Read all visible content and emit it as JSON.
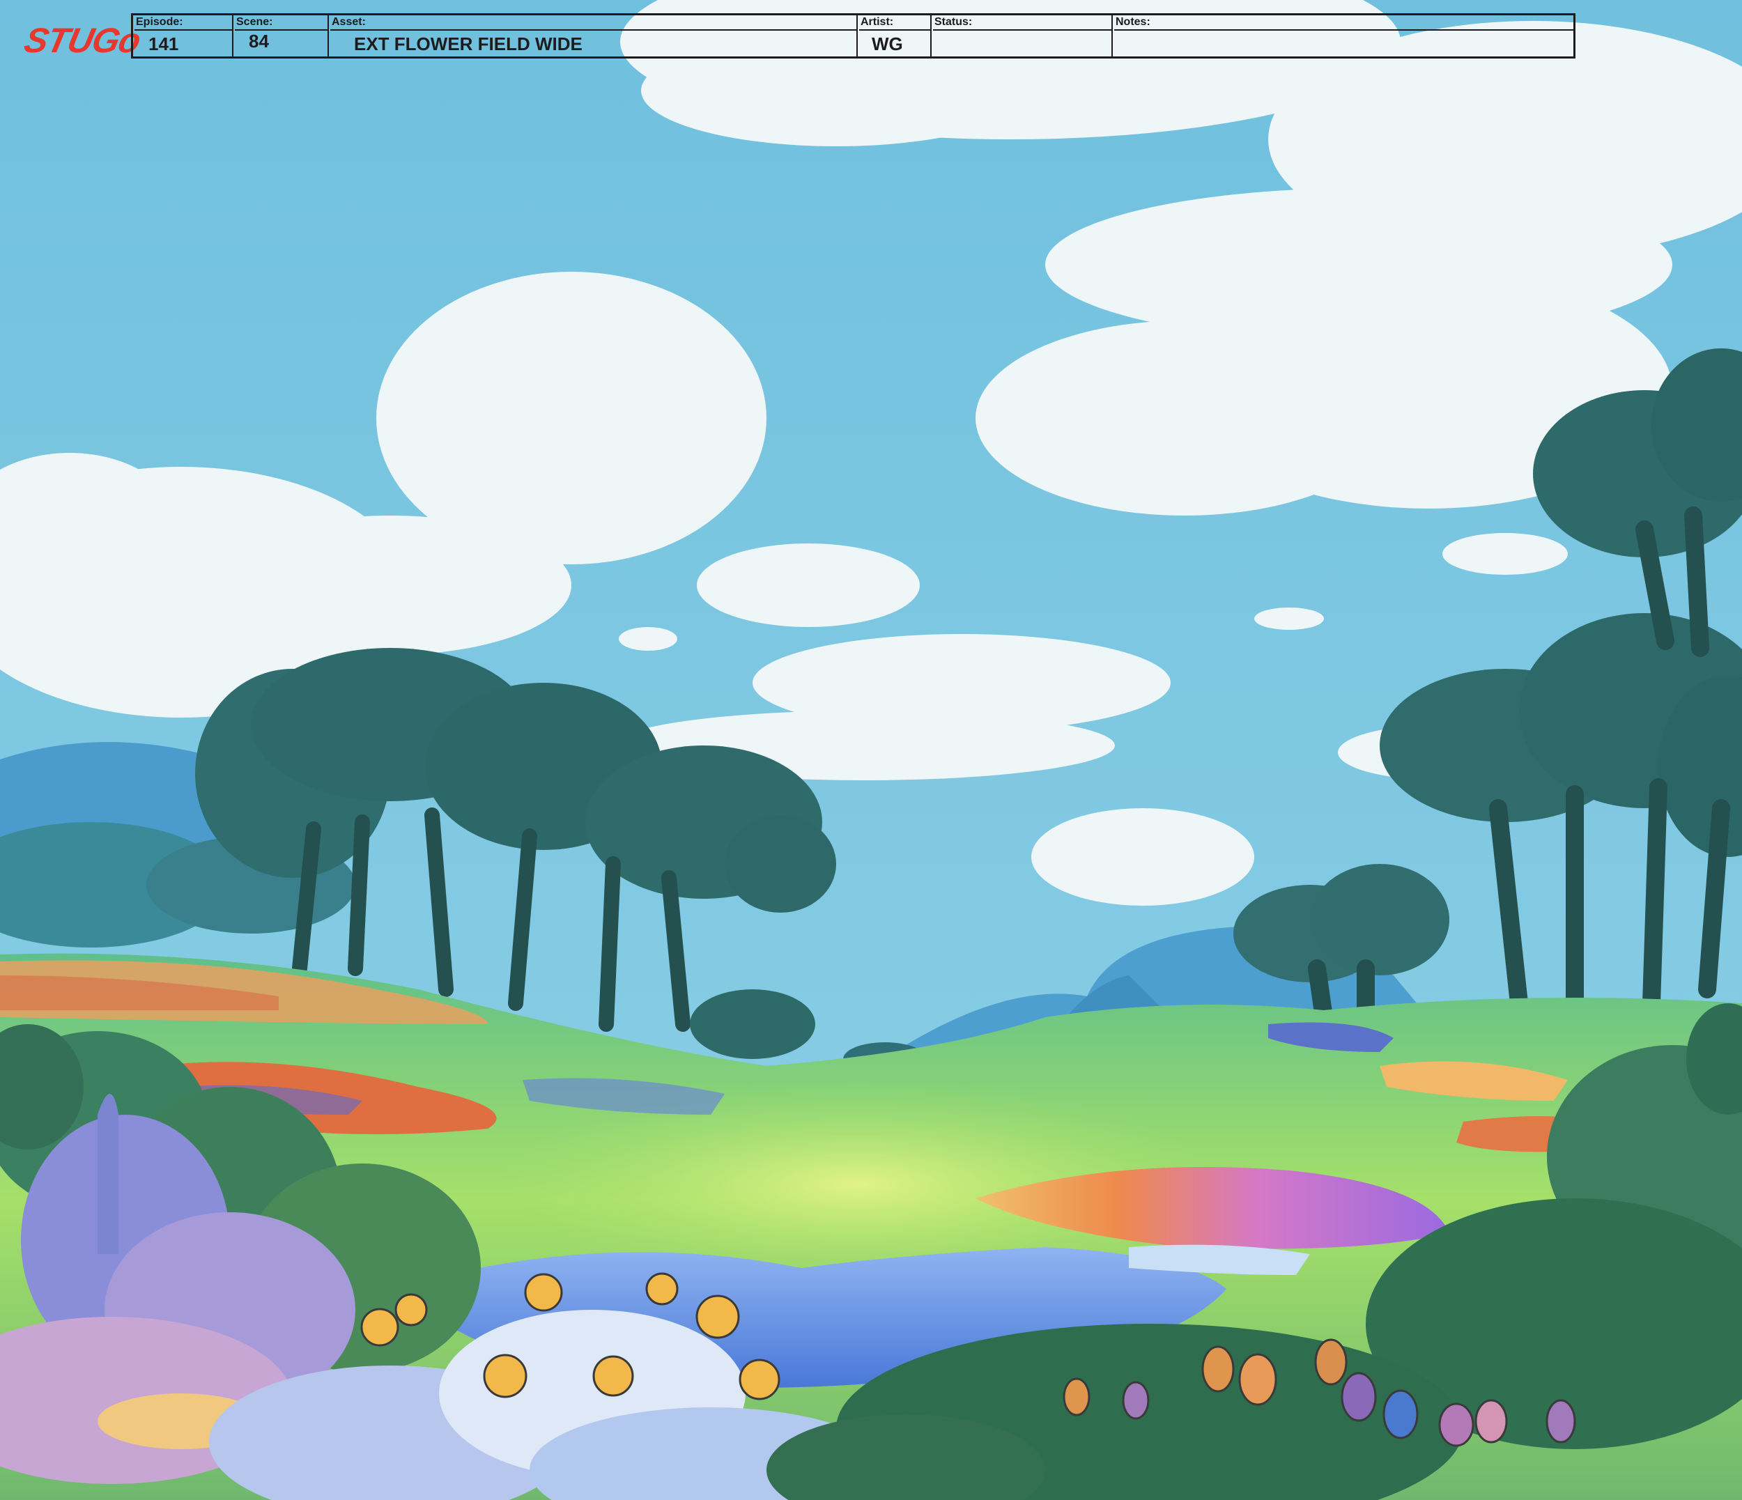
{
  "logo": {
    "text": "STUGo"
  },
  "slate": {
    "episode_label": "Episode:",
    "episode_value": "141",
    "scene_label": "Scene:",
    "scene_value": "84",
    "asset_label": "Asset:",
    "asset_value": "EXT FLOWER FIELD WIDE",
    "artist_label": "Artist:",
    "artist_value": "WG",
    "status_label": "Status:",
    "status_value": "",
    "notes_label": "Notes:",
    "notes_value": ""
  },
  "palette": {
    "sky": "#74c2df",
    "cloud": "#eef6f8",
    "hills_far": "#4a9cc4",
    "tree_dark": "#2f6a6a",
    "grass": "#8cd46a",
    "flower_orange": "#e6804a",
    "flower_yellow": "#f0c04a",
    "flower_purple": "#9a8ad0",
    "logo_red": "#e8372c"
  }
}
